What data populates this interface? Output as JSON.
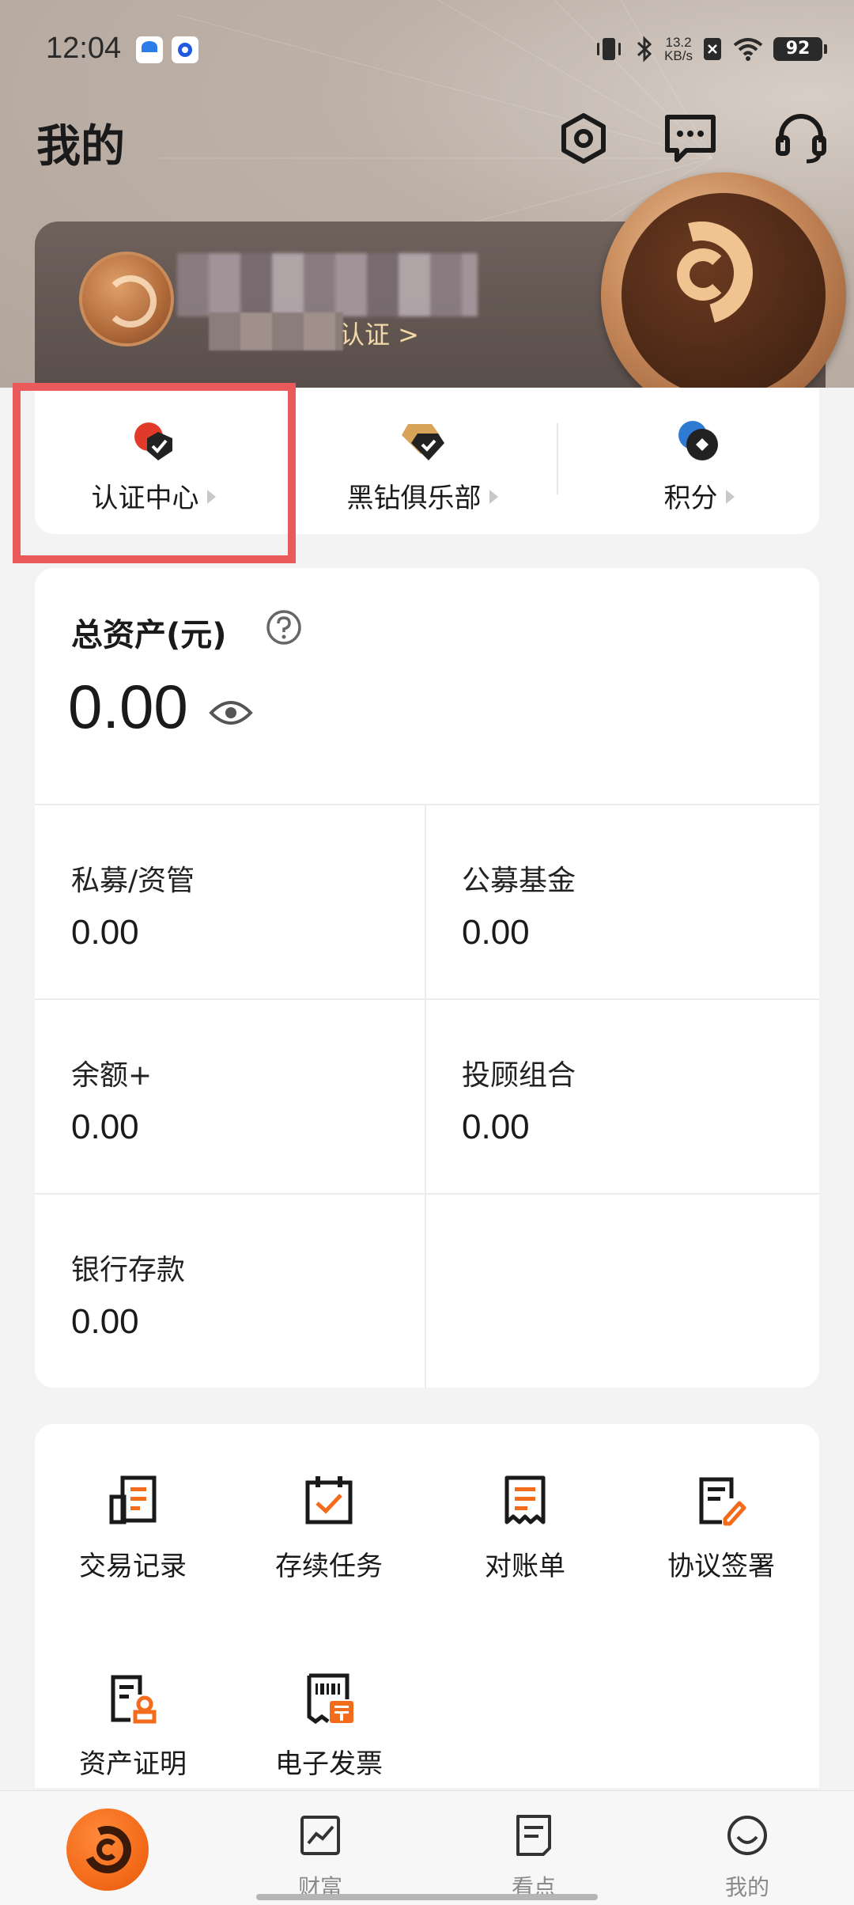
{
  "status_bar": {
    "time": "12:04",
    "net_speed_value": "13.2",
    "net_speed_unit": "KB/s",
    "battery": "92"
  },
  "header": {
    "title": "我的",
    "icons": [
      "settings-icon",
      "message-icon",
      "customer-service-icon"
    ]
  },
  "profile": {
    "auth_hint": "请完成平台认证 >"
  },
  "quick_links": [
    {
      "label": "认证中心",
      "icon": "certification-icon"
    },
    {
      "label": "黑钻俱乐部",
      "icon": "black-diamond-icon"
    },
    {
      "label": "积分",
      "icon": "points-icon"
    }
  ],
  "assets": {
    "title": "总资产(元)",
    "total": "0.00",
    "items": [
      {
        "label": "私募/资管",
        "value": "0.00"
      },
      {
        "label": "公募基金",
        "value": "0.00"
      },
      {
        "label": "余额+",
        "value": "0.00"
      },
      {
        "label": "投顾组合",
        "value": "0.00"
      },
      {
        "label": "银行存款",
        "value": "0.00"
      }
    ]
  },
  "tools": [
    {
      "label": "交易记录",
      "icon": "transaction-record-icon"
    },
    {
      "label": "存续任务",
      "icon": "task-calendar-icon"
    },
    {
      "label": "对账单",
      "icon": "statement-icon"
    },
    {
      "label": "协议签署",
      "icon": "agreement-sign-icon"
    },
    {
      "label": "资产证明",
      "icon": "asset-certificate-icon"
    },
    {
      "label": "电子发票",
      "icon": "e-invoice-icon"
    }
  ],
  "bottom_nav": [
    {
      "label": "",
      "icon": "home-logo-icon"
    },
    {
      "label": "财富",
      "icon": "wealth-chart-icon"
    },
    {
      "label": "看点",
      "icon": "news-icon"
    },
    {
      "label": "我的",
      "icon": "smiley-icon"
    }
  ],
  "colors": {
    "accent": "#f36c1b",
    "highlight_box": "#ea5a5a",
    "auth_hint": "#f4d9a8"
  }
}
